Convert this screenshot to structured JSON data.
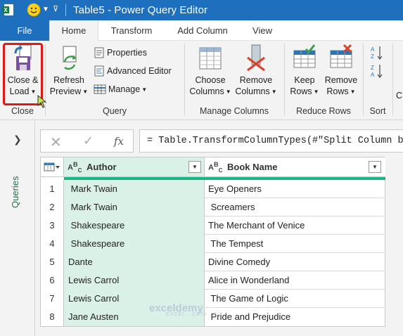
{
  "window": {
    "title": "Table5 - Power Query Editor"
  },
  "tabs": [
    "File",
    "Home",
    "Transform",
    "Add Column",
    "View"
  ],
  "ribbon": {
    "close_group": {
      "label": "Close",
      "close_load": "Close &",
      "close_load2": "Load"
    },
    "query_group": {
      "label": "Query",
      "refresh": "Refresh",
      "refresh2": "Preview",
      "properties": "Properties",
      "advanced_editor": "Advanced Editor",
      "manage": "Manage"
    },
    "manage_columns_group": {
      "label": "Manage Columns",
      "choose": "Choose",
      "choose2": "Columns",
      "remove": "Remove",
      "remove2": "Columns"
    },
    "reduce_rows_group": {
      "label": "Reduce Rows",
      "keep": "Keep",
      "keep2": "Rows",
      "remove": "Remove",
      "remove2": "Rows"
    },
    "sort_group": {
      "label": "Sort"
    },
    "partial": "C"
  },
  "queries_pane": {
    "label": "Queries"
  },
  "formula_bar": {
    "fx": "fx",
    "formula": "= Table.TransformColumnTypes(#\"Split Column b"
  },
  "grid": {
    "columns": [
      {
        "type": "ABC",
        "name": "Author"
      },
      {
        "type": "ABC",
        "name": "Book Name"
      }
    ],
    "rows": [
      {
        "n": "1",
        "author": " Mark Twain",
        "book": "Eye Openers"
      },
      {
        "n": "2",
        "author": " Mark Twain",
        "book": " Screamers"
      },
      {
        "n": "3",
        "author": " Shakespeare",
        "book": "The Merchant of Venice"
      },
      {
        "n": "4",
        "author": " Shakespeare",
        "book": " The Tempest"
      },
      {
        "n": "5",
        "author": "Dante",
        "book": "Divine Comedy"
      },
      {
        "n": "6",
        "author": "Lewis Carrol",
        "book": "Alice in Wonderland"
      },
      {
        "n": "7",
        "author": "Lewis Carrol",
        "book": " The Game of Logic"
      },
      {
        "n": "8",
        "author": "Jane Austen",
        "book": " Pride and Prejudice"
      }
    ]
  },
  "watermark": {
    "brand": "exceldemy",
    "tagline": "EXCEL · DATA · BI"
  },
  "colors": {
    "titlebar": "#1f6fbf",
    "highlight": "#e01818",
    "column_selected": "#d9f1e6",
    "accent_green": "#19b787"
  }
}
